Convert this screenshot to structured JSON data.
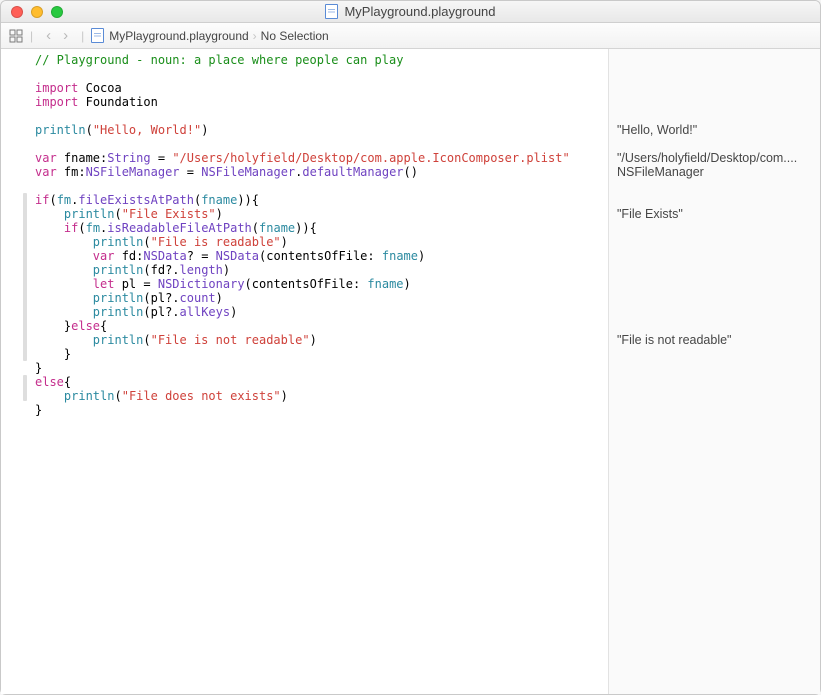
{
  "title": "MyPlayground.playground",
  "pathbar": {
    "file": "MyPlayground.playground",
    "selection": "No Selection"
  },
  "code": {
    "l1_comment": "// Playground - noun: a place where people can play",
    "l3_kw": "import",
    "l3_id": "Cocoa",
    "l4_kw": "import",
    "l4_id": "Foundation",
    "l6_fn": "println",
    "l6_str": "\"Hello, World!\"",
    "l8_kw": "var",
    "l8_name": " fname",
    "l8_type": "String",
    "l8_str": "\"/Users/holyfield/Desktop/com.apple.IconComposer.plist\"",
    "l9_kw": "var",
    "l9_name": " fm",
    "l9_type": "NSFileManager",
    "l9_type2": "NSFileManager",
    "l9_method": "defaultManager",
    "l11_kw": "if",
    "l11_obj": "fm",
    "l11_m": "fileExistsAtPath",
    "l11_arg": "fname",
    "l12_fn": "println",
    "l12_str": "\"File Exists\"",
    "l13_kw": "if",
    "l13_obj": "fm",
    "l13_m": "isReadableFileAtPath",
    "l13_arg": "fname",
    "l14_fn": "println",
    "l14_str": "\"File is readable\"",
    "l15_kw": "var",
    "l15_name": " fd",
    "l15_type": "NSData",
    "l15_ctor": "NSData",
    "l15_param": "contentsOfFile",
    "l15_arg": "fname",
    "l16_fn": "println",
    "l16_obj": "fd",
    "l16_prop": "length",
    "l17_kw": "let",
    "l17_name": " pl = ",
    "l17_ctor": "NSDictionary",
    "l17_param": "contentsOfFile",
    "l17_arg": "fname",
    "l18_fn": "println",
    "l18_obj": "pl",
    "l18_prop": "count",
    "l19_fn": "println",
    "l19_obj": "pl",
    "l19_prop": "allKeys",
    "l20_kw": "else",
    "l21_fn": "println",
    "l21_str": "\"File is not readable\"",
    "l24_kw": "else",
    "l25_fn": "println",
    "l25_str": "\"File does not exists\""
  },
  "results": {
    "r1": "\"Hello, World!\"",
    "r2": "\"/Users/holyfield/Desktop/com....",
    "r3": "NSFileManager",
    "r4": "\"File Exists\"",
    "r5": "\"File is not readable\""
  }
}
